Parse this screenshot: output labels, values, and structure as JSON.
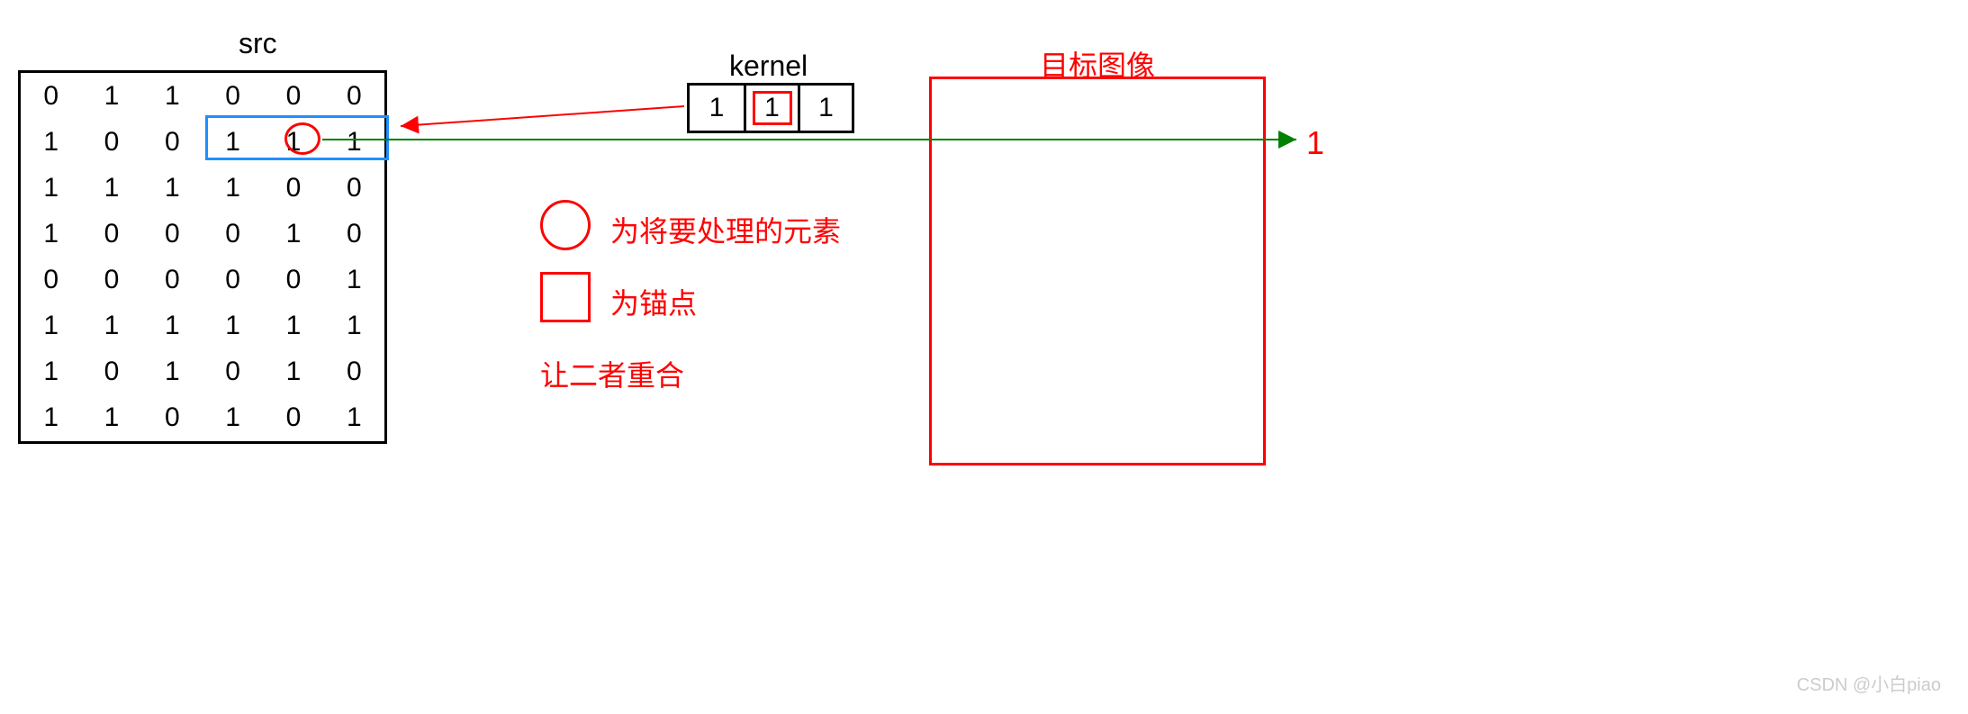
{
  "labels": {
    "src": "src",
    "kernel": "kernel",
    "target": "目标图像",
    "result_value": "1",
    "legend_circle": "为将要处理的元素",
    "legend_square": "为锚点",
    "legend_overlap": "让二者重合",
    "watermark": "CSDN @小白piao"
  },
  "src_matrix": [
    [
      0,
      1,
      1,
      0,
      0,
      0
    ],
    [
      1,
      0,
      0,
      1,
      1,
      1
    ],
    [
      1,
      1,
      1,
      1,
      0,
      0
    ],
    [
      1,
      0,
      0,
      0,
      1,
      0
    ],
    [
      0,
      0,
      0,
      0,
      0,
      1
    ],
    [
      1,
      1,
      1,
      1,
      1,
      1
    ],
    [
      1,
      0,
      1,
      0,
      1,
      0
    ],
    [
      1,
      1,
      0,
      1,
      0,
      1
    ]
  ],
  "kernel_values": [
    1,
    1,
    1
  ],
  "highlighted_cell": {
    "row": 1,
    "col": 4
  },
  "highlighted_region": {
    "row": 1,
    "cols": [
      3,
      4,
      5
    ]
  }
}
